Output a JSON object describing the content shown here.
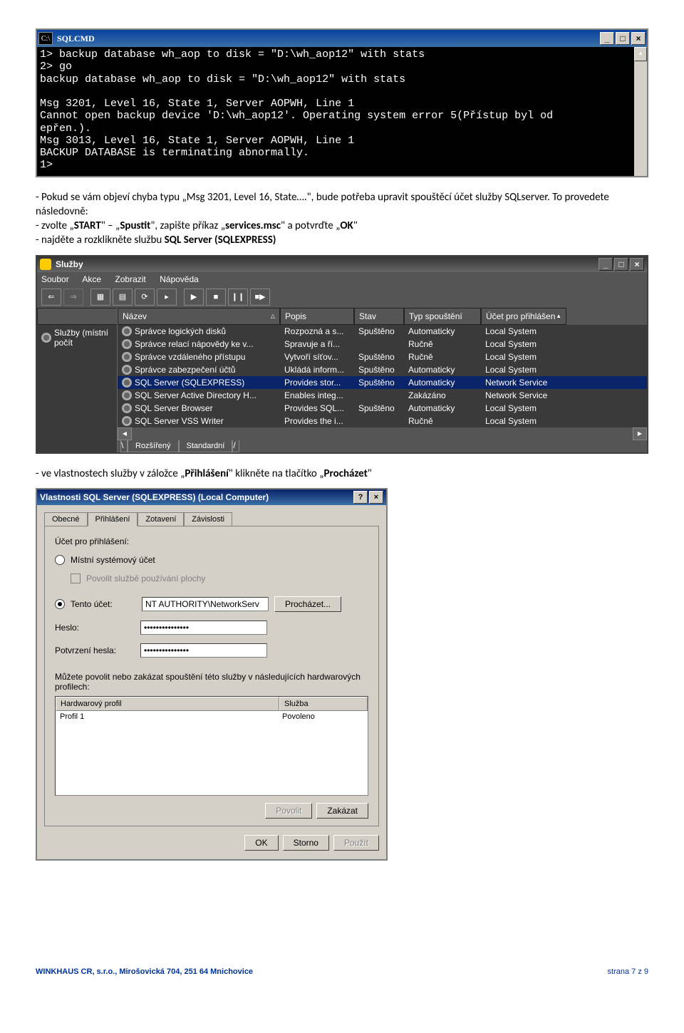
{
  "cmd_window": {
    "title": "SQLCMD",
    "lines": "1> backup database wh_aop to disk = \"D:\\wh_aop12\" with stats\n2> go\nbackup database wh_aop to disk = \"D:\\wh_aop12\" with stats\n\nMsg 3201, Level 16, State 1, Server AOPWH, Line 1\nCannot open backup device 'D:\\wh_aop12'. Operating system error 5(Přístup byl od\nepřen.).\nMsg 3013, Level 16, State 1, Server AOPWH, Line 1\nBACKUP DATABASE is terminating abnormally.\n1>"
  },
  "instr": {
    "p1_a": "- Pokud se vám objeví chyba typu „Msg 3201, Level 16, State….\", bude potřeba upravit spouštěcí účet služby SQLserver.",
    "p1_b": "To provedete následovně:",
    "p2_a": "- zvolte „",
    "p2_b": "START",
    "p2_c": "\" – „",
    "p2_d": "Spustit",
    "p2_e": "\", zapište příkaz „",
    "p2_f": "services.msc",
    "p2_g": "\" a potvrďte „",
    "p2_h": "OK",
    "p2_i": "\"",
    "p3_a": "- najděte a rozklikněte službu ",
    "p3_b": "SQL Server (SQLEXPRESS)",
    "p4_a": "- ve vlastnostech služby v záložce „",
    "p4_b": "Přihlášení",
    "p4_c": "\" klikněte na tlačítko „",
    "p4_d": "Procházet",
    "p4_e": "\""
  },
  "svc_window": {
    "title": "Služby",
    "menu": [
      "Soubor",
      "Akce",
      "Zobrazit",
      "Nápověda"
    ],
    "left_header": "Služby (místní počít",
    "columns": [
      "Název",
      "Popis",
      "Stav",
      "Typ spouštění",
      "Účet pro přihlášen"
    ],
    "rows": [
      {
        "name": "Správce logických disků",
        "desc": "Rozpozná a s...",
        "status": "Spuštěno",
        "start": "Automaticky",
        "login": "Local System"
      },
      {
        "name": "Správce relací nápovědy ke v...",
        "desc": "Spravuje a ří...",
        "status": "",
        "start": "Ručně",
        "login": "Local System"
      },
      {
        "name": "Správce vzdáleného přístupu",
        "desc": "Vytvoří síťov...",
        "status": "Spuštěno",
        "start": "Ručně",
        "login": "Local System"
      },
      {
        "name": "Správce zabezpečení účtů",
        "desc": "Ukládá inform...",
        "status": "Spuštěno",
        "start": "Automaticky",
        "login": "Local System"
      },
      {
        "name": "SQL Server (SQLEXPRESS)",
        "desc": "Provides stor...",
        "status": "Spuštěno",
        "start": "Automaticky",
        "login": "Network Service",
        "sel": true
      },
      {
        "name": "SQL Server Active Directory H...",
        "desc": "Enables integ...",
        "status": "",
        "start": "Zakázáno",
        "login": "Network Service"
      },
      {
        "name": "SQL Server Browser",
        "desc": "Provides SQL...",
        "status": "Spuštěno",
        "start": "Automaticky",
        "login": "Local System"
      },
      {
        "name": "SQL Server VSS Writer",
        "desc": "Provides the i...",
        "status": "",
        "start": "Ručně",
        "login": "Local System"
      }
    ],
    "tabs": [
      "Rozšířený",
      "Standardní"
    ]
  },
  "prop": {
    "title": "Vlastnosti SQL Server (SQLEXPRESS) (Local Computer)",
    "tabs": [
      "Obecné",
      "Přihlášení",
      "Zotavení",
      "Závislosti"
    ],
    "section_label": "Účet pro přihlášení:",
    "radio_local": "Místní systémový účet",
    "checkbox": "Povolit službě používání plochy",
    "radio_account": "Tento účet:",
    "account_value": "NT AUTHORITY\\NetworkServ",
    "browse_btn": "Procházet...",
    "pwd_label": "Heslo:",
    "pwd_value": "•••••••••••••••",
    "pwd2_label": "Potvrzení hesla:",
    "pwd2_value": "•••••••••••••••",
    "hw_text": "Můžete povolit nebo zakázat spouštění této služby v následujících hardwarových profilech:",
    "hw_col1": "Hardwarový profil",
    "hw_col2": "Služba",
    "hw_r1c1": "Profil 1",
    "hw_r1c2": "Povoleno",
    "btn_enable": "Povolit",
    "btn_disable": "Zakázat",
    "btn_ok": "OK",
    "btn_cancel": "Storno",
    "btn_apply": "Použít"
  },
  "footer": {
    "left": "WINKHAUS CR, s.r.o., Mirošovická 704, 251 64 Mnichovice",
    "right": "strana 7 z 9"
  }
}
